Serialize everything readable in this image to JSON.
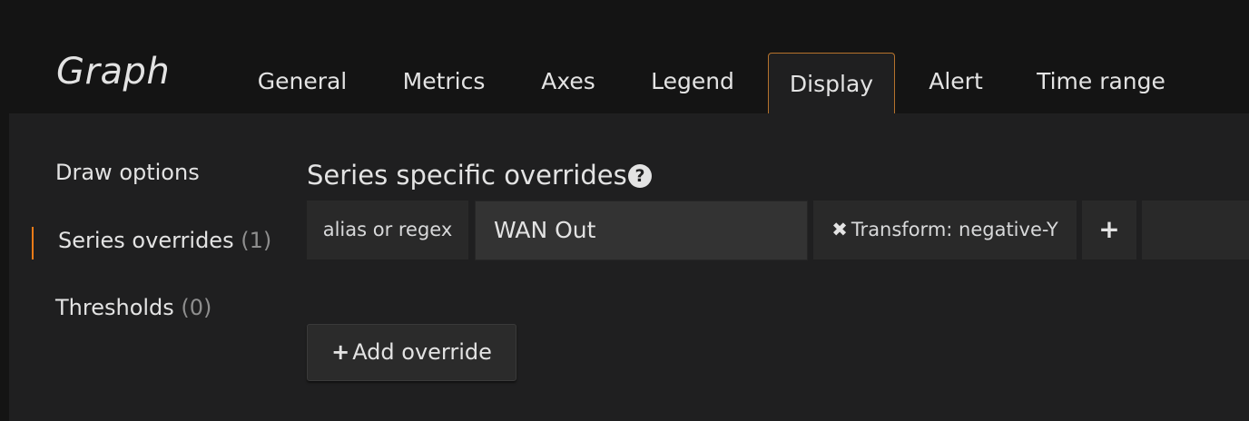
{
  "header": {
    "title": "Graph",
    "tabs": [
      {
        "label": "General",
        "active": false
      },
      {
        "label": "Metrics",
        "active": false
      },
      {
        "label": "Axes",
        "active": false
      },
      {
        "label": "Legend",
        "active": false
      },
      {
        "label": "Display",
        "active": true
      },
      {
        "label": "Alert",
        "active": false
      },
      {
        "label": "Time range",
        "active": false
      }
    ]
  },
  "sidebar": {
    "items": [
      {
        "label": "Draw options",
        "count": ""
      },
      {
        "label": "Series overrides",
        "count": "(1)"
      },
      {
        "label": "Thresholds",
        "count": "(0)"
      }
    ]
  },
  "main": {
    "section_title": "Series specific overrides",
    "help_icon": "?",
    "override": {
      "alias_label": "alias or regex",
      "alias_value": "WAN Out",
      "remove_glyph": "✖",
      "transform_label": "Transform: negative-Y",
      "add_option_glyph": "+"
    },
    "add_override": {
      "glyph": "+",
      "label": "Add override"
    }
  },
  "colors": {
    "accent": "#eb7b18",
    "active_tab_border": "#b5722c",
    "background": "#141414",
    "panel": "#1f1f20"
  }
}
